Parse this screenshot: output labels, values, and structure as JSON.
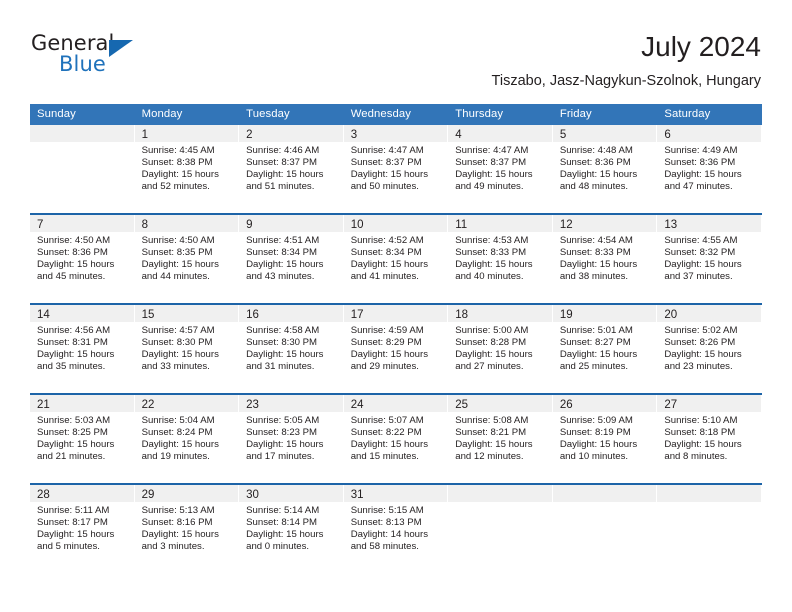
{
  "brand": {
    "word_general": "General",
    "word_blue": "Blue",
    "logo_icon": "triangle-logo-icon",
    "accent_color": "#1668b0"
  },
  "header": {
    "title": "July 2024",
    "subtitle": "Tiszabo, Jasz-Nagykun-Szolnok, Hungary"
  },
  "calendar": {
    "header_bg": "#3275b8",
    "row_divider": "#1d64a8",
    "daynum_band_bg": "#f0f0f0",
    "weekdays": [
      "Sunday",
      "Monday",
      "Tuesday",
      "Wednesday",
      "Thursday",
      "Friday",
      "Saturday"
    ],
    "weeks": [
      [
        {
          "day": "",
          "empty": true
        },
        {
          "day": "1",
          "sunrise": "Sunrise: 4:45 AM",
          "sunset": "Sunset: 8:38 PM",
          "daylight_line1": "Daylight: 15 hours",
          "daylight_line2": "and 52 minutes."
        },
        {
          "day": "2",
          "sunrise": "Sunrise: 4:46 AM",
          "sunset": "Sunset: 8:37 PM",
          "daylight_line1": "Daylight: 15 hours",
          "daylight_line2": "and 51 minutes."
        },
        {
          "day": "3",
          "sunrise": "Sunrise: 4:47 AM",
          "sunset": "Sunset: 8:37 PM",
          "daylight_line1": "Daylight: 15 hours",
          "daylight_line2": "and 50 minutes."
        },
        {
          "day": "4",
          "sunrise": "Sunrise: 4:47 AM",
          "sunset": "Sunset: 8:37 PM",
          "daylight_line1": "Daylight: 15 hours",
          "daylight_line2": "and 49 minutes."
        },
        {
          "day": "5",
          "sunrise": "Sunrise: 4:48 AM",
          "sunset": "Sunset: 8:36 PM",
          "daylight_line1": "Daylight: 15 hours",
          "daylight_line2": "and 48 minutes."
        },
        {
          "day": "6",
          "sunrise": "Sunrise: 4:49 AM",
          "sunset": "Sunset: 8:36 PM",
          "daylight_line1": "Daylight: 15 hours",
          "daylight_line2": "and 47 minutes."
        }
      ],
      [
        {
          "day": "7",
          "sunrise": "Sunrise: 4:50 AM",
          "sunset": "Sunset: 8:36 PM",
          "daylight_line1": "Daylight: 15 hours",
          "daylight_line2": "and 45 minutes."
        },
        {
          "day": "8",
          "sunrise": "Sunrise: 4:50 AM",
          "sunset": "Sunset: 8:35 PM",
          "daylight_line1": "Daylight: 15 hours",
          "daylight_line2": "and 44 minutes."
        },
        {
          "day": "9",
          "sunrise": "Sunrise: 4:51 AM",
          "sunset": "Sunset: 8:34 PM",
          "daylight_line1": "Daylight: 15 hours",
          "daylight_line2": "and 43 minutes."
        },
        {
          "day": "10",
          "sunrise": "Sunrise: 4:52 AM",
          "sunset": "Sunset: 8:34 PM",
          "daylight_line1": "Daylight: 15 hours",
          "daylight_line2": "and 41 minutes."
        },
        {
          "day": "11",
          "sunrise": "Sunrise: 4:53 AM",
          "sunset": "Sunset: 8:33 PM",
          "daylight_line1": "Daylight: 15 hours",
          "daylight_line2": "and 40 minutes."
        },
        {
          "day": "12",
          "sunrise": "Sunrise: 4:54 AM",
          "sunset": "Sunset: 8:33 PM",
          "daylight_line1": "Daylight: 15 hours",
          "daylight_line2": "and 38 minutes."
        },
        {
          "day": "13",
          "sunrise": "Sunrise: 4:55 AM",
          "sunset": "Sunset: 8:32 PM",
          "daylight_line1": "Daylight: 15 hours",
          "daylight_line2": "and 37 minutes."
        }
      ],
      [
        {
          "day": "14",
          "sunrise": "Sunrise: 4:56 AM",
          "sunset": "Sunset: 8:31 PM",
          "daylight_line1": "Daylight: 15 hours",
          "daylight_line2": "and 35 minutes."
        },
        {
          "day": "15",
          "sunrise": "Sunrise: 4:57 AM",
          "sunset": "Sunset: 8:30 PM",
          "daylight_line1": "Daylight: 15 hours",
          "daylight_line2": "and 33 minutes."
        },
        {
          "day": "16",
          "sunrise": "Sunrise: 4:58 AM",
          "sunset": "Sunset: 8:30 PM",
          "daylight_line1": "Daylight: 15 hours",
          "daylight_line2": "and 31 minutes."
        },
        {
          "day": "17",
          "sunrise": "Sunrise: 4:59 AM",
          "sunset": "Sunset: 8:29 PM",
          "daylight_line1": "Daylight: 15 hours",
          "daylight_line2": "and 29 minutes."
        },
        {
          "day": "18",
          "sunrise": "Sunrise: 5:00 AM",
          "sunset": "Sunset: 8:28 PM",
          "daylight_line1": "Daylight: 15 hours",
          "daylight_line2": "and 27 minutes."
        },
        {
          "day": "19",
          "sunrise": "Sunrise: 5:01 AM",
          "sunset": "Sunset: 8:27 PM",
          "daylight_line1": "Daylight: 15 hours",
          "daylight_line2": "and 25 minutes."
        },
        {
          "day": "20",
          "sunrise": "Sunrise: 5:02 AM",
          "sunset": "Sunset: 8:26 PM",
          "daylight_line1": "Daylight: 15 hours",
          "daylight_line2": "and 23 minutes."
        }
      ],
      [
        {
          "day": "21",
          "sunrise": "Sunrise: 5:03 AM",
          "sunset": "Sunset: 8:25 PM",
          "daylight_line1": "Daylight: 15 hours",
          "daylight_line2": "and 21 minutes."
        },
        {
          "day": "22",
          "sunrise": "Sunrise: 5:04 AM",
          "sunset": "Sunset: 8:24 PM",
          "daylight_line1": "Daylight: 15 hours",
          "daylight_line2": "and 19 minutes."
        },
        {
          "day": "23",
          "sunrise": "Sunrise: 5:05 AM",
          "sunset": "Sunset: 8:23 PM",
          "daylight_line1": "Daylight: 15 hours",
          "daylight_line2": "and 17 minutes."
        },
        {
          "day": "24",
          "sunrise": "Sunrise: 5:07 AM",
          "sunset": "Sunset: 8:22 PM",
          "daylight_line1": "Daylight: 15 hours",
          "daylight_line2": "and 15 minutes."
        },
        {
          "day": "25",
          "sunrise": "Sunrise: 5:08 AM",
          "sunset": "Sunset: 8:21 PM",
          "daylight_line1": "Daylight: 15 hours",
          "daylight_line2": "and 12 minutes."
        },
        {
          "day": "26",
          "sunrise": "Sunrise: 5:09 AM",
          "sunset": "Sunset: 8:19 PM",
          "daylight_line1": "Daylight: 15 hours",
          "daylight_line2": "and 10 minutes."
        },
        {
          "day": "27",
          "sunrise": "Sunrise: 5:10 AM",
          "sunset": "Sunset: 8:18 PM",
          "daylight_line1": "Daylight: 15 hours",
          "daylight_line2": "and 8 minutes."
        }
      ],
      [
        {
          "day": "28",
          "sunrise": "Sunrise: 5:11 AM",
          "sunset": "Sunset: 8:17 PM",
          "daylight_line1": "Daylight: 15 hours",
          "daylight_line2": "and 5 minutes."
        },
        {
          "day": "29",
          "sunrise": "Sunrise: 5:13 AM",
          "sunset": "Sunset: 8:16 PM",
          "daylight_line1": "Daylight: 15 hours",
          "daylight_line2": "and 3 minutes."
        },
        {
          "day": "30",
          "sunrise": "Sunrise: 5:14 AM",
          "sunset": "Sunset: 8:14 PM",
          "daylight_line1": "Daylight: 15 hours",
          "daylight_line2": "and 0 minutes."
        },
        {
          "day": "31",
          "sunrise": "Sunrise: 5:15 AM",
          "sunset": "Sunset: 8:13 PM",
          "daylight_line1": "Daylight: 14 hours",
          "daylight_line2": "and 58 minutes."
        },
        {
          "day": "",
          "empty": true
        },
        {
          "day": "",
          "empty": true
        },
        {
          "day": "",
          "empty": true
        }
      ]
    ]
  }
}
